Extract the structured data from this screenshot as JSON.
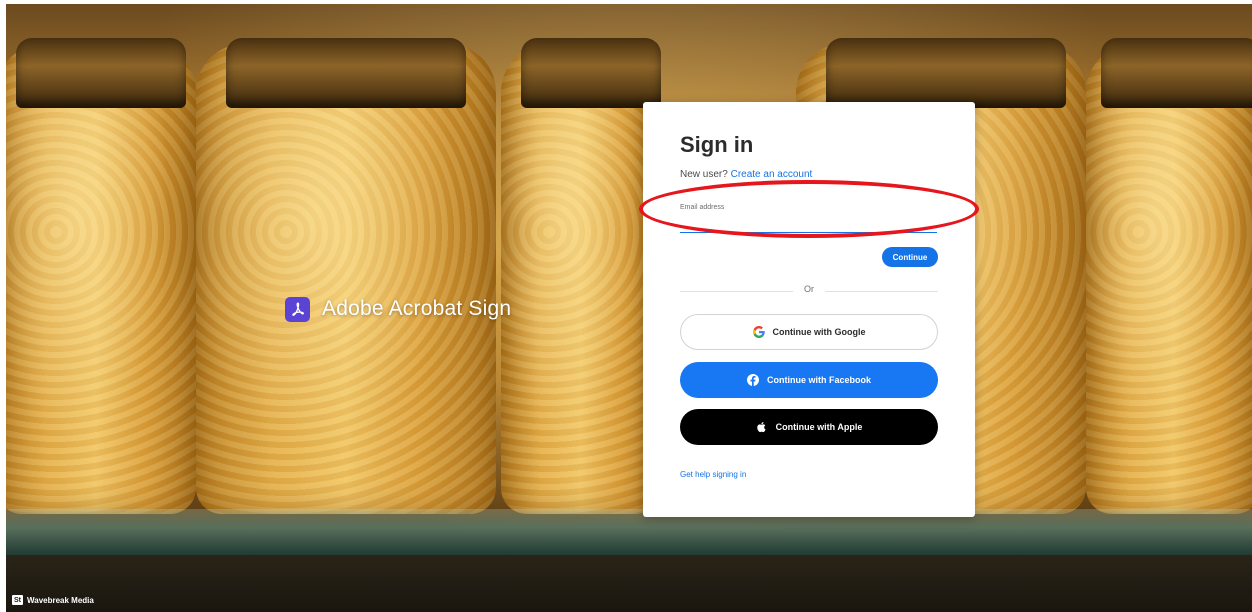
{
  "brand": {
    "name": "Adobe Acrobat Sign",
    "icon": "acrobat-logo-icon",
    "icon_color": "#5b43d6"
  },
  "credit": {
    "badge": "St",
    "text": "Wavebreak Media"
  },
  "signin": {
    "title": "Sign in",
    "new_user_text": "New user?",
    "create_account_link": "Create an account",
    "email_label": "Email address",
    "email_value": "",
    "continue_label": "Continue",
    "or_text": "Or",
    "google_label": "Continue with Google",
    "facebook_label": "Continue with Facebook",
    "apple_label": "Continue with Apple",
    "help_link": "Get help signing in"
  },
  "colors": {
    "primary_blue": "#1473e6",
    "facebook_blue": "#1877f2",
    "apple_black": "#000000",
    "annotation_red": "#e5161c"
  },
  "icons": {
    "google": "google-g-icon",
    "facebook": "facebook-icon",
    "apple": "apple-icon"
  }
}
